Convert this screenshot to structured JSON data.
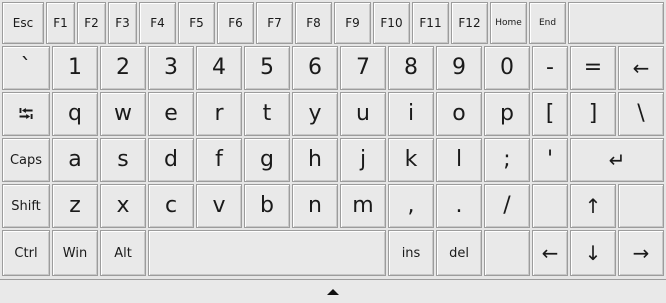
{
  "keyboard": {
    "fn_row": [
      "Esc",
      "F1",
      "F2",
      "F3",
      "F4",
      "F5",
      "F6",
      "F7",
      "F8",
      "F9",
      "F10",
      "F11",
      "F12",
      "Home",
      "End"
    ],
    "num_row": [
      "`",
      "1",
      "2",
      "3",
      "4",
      "5",
      "6",
      "7",
      "8",
      "9",
      "0",
      "-",
      "=",
      "←"
    ],
    "q_row": [
      "⭾",
      "q",
      "w",
      "e",
      "r",
      "t",
      "y",
      "u",
      "i",
      "o",
      "p",
      "[",
      "]",
      "\\"
    ],
    "a_row": [
      "Caps",
      "a",
      "s",
      "d",
      "f",
      "g",
      "h",
      "j",
      "k",
      "l",
      ";",
      "'",
      "↵"
    ],
    "z_row": [
      "Shift",
      "z",
      "x",
      "c",
      "v",
      "b",
      "n",
      "m",
      ",",
      ".",
      "/",
      "↑"
    ],
    "bottom_row": [
      "Ctrl",
      "Win",
      "Alt",
      "",
      "ins",
      "del",
      "←",
      "↓",
      "→"
    ],
    "collapse_toggle": "▲"
  }
}
